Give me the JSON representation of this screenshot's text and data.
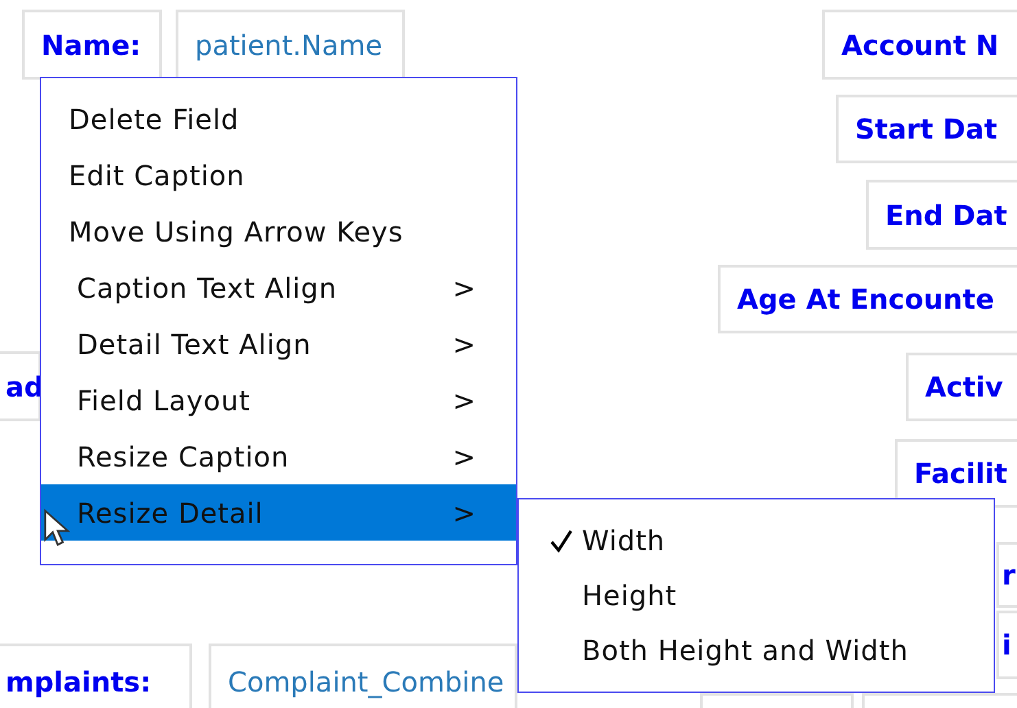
{
  "fields": [
    {
      "kind": "caption",
      "text": "Name:"
    },
    {
      "kind": "detail",
      "text": "patient.Name"
    },
    {
      "kind": "caption",
      "text": "Account N"
    },
    {
      "kind": "caption",
      "text": "Start Dat"
    },
    {
      "kind": "caption",
      "text": "End Dat"
    },
    {
      "kind": "caption",
      "text": "Age At Encounte"
    },
    {
      "kind": "caption",
      "text": "ad"
    },
    {
      "kind": "caption",
      "text": "Activ"
    },
    {
      "kind": "caption",
      "text": "Facilit"
    },
    {
      "kind": "caption",
      "text": "r"
    },
    {
      "kind": "caption",
      "text": "i"
    },
    {
      "kind": "caption",
      "text": "mplaints:"
    },
    {
      "kind": "detail",
      "text": "Complaint_Combine"
    }
  ],
  "context_menu": {
    "items": [
      {
        "kind": "action",
        "label": "Delete Field",
        "selected": false
      },
      {
        "kind": "action",
        "label": "Edit Caption",
        "selected": false
      },
      {
        "kind": "action",
        "label": "Move Using Arrow Keys",
        "selected": false
      },
      {
        "kind": "submenu",
        "label": "Caption Text Align",
        "arrow": ">",
        "selected": false
      },
      {
        "kind": "submenu",
        "label": "Detail Text Align",
        "arrow": ">",
        "selected": false
      },
      {
        "kind": "submenu",
        "label": "Field Layout",
        "arrow": ">",
        "selected": false
      },
      {
        "kind": "submenu",
        "label": "Resize Caption",
        "arrow": ">",
        "selected": false
      },
      {
        "kind": "submenu",
        "label": "Resize Detail",
        "arrow": ">",
        "selected": true
      }
    ]
  },
  "submenu": {
    "items": [
      {
        "label": "Width",
        "checked": true
      },
      {
        "label": "Height",
        "checked": false
      },
      {
        "label": "Both Height and Width",
        "checked": false
      }
    ]
  }
}
